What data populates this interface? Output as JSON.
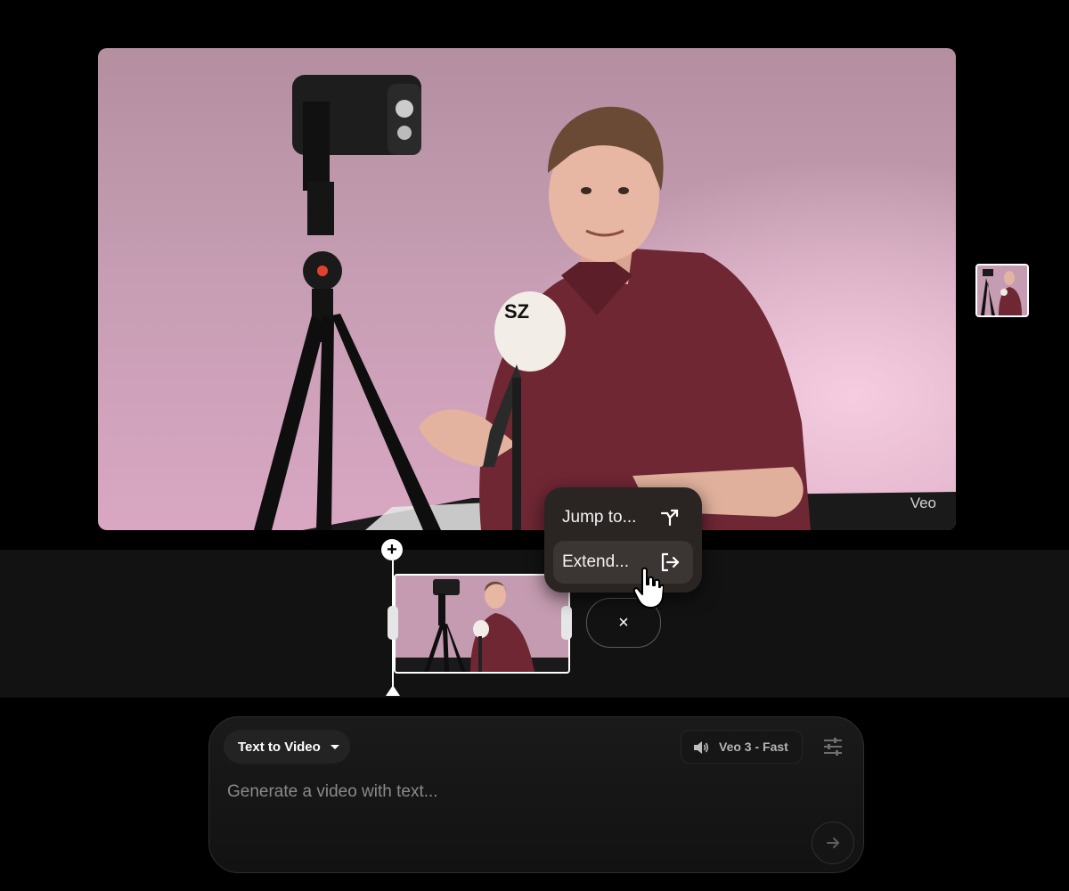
{
  "preview": {
    "watermark": "Veo",
    "mic_text": "SZ"
  },
  "timeline": {
    "add_label": "+",
    "close_label": "×"
  },
  "menu": {
    "items": [
      {
        "label": "Jump to...",
        "icon": "jump-arrow-icon"
      },
      {
        "label": "Extend...",
        "icon": "extend-exit-icon"
      }
    ]
  },
  "prompt": {
    "mode_label": "Text to Video",
    "model_label": "Veo 3 - Fast",
    "placeholder": "Generate a video with text..."
  },
  "colors": {
    "background": "#000000",
    "timeline_bg": "#121212",
    "menu_bg": "#2a2523",
    "shirt": "#6f2734",
    "wall": "#c49bb0"
  }
}
